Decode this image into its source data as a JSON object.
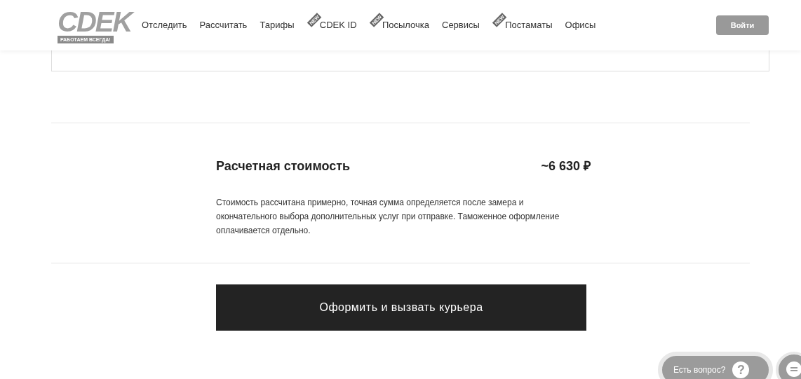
{
  "header": {
    "logo": {
      "wordmark": "CDEK",
      "slogan": "РАБОТАЕМ ВСЕГДА!"
    },
    "nav": [
      {
        "label": "Отследить"
      },
      {
        "label": "Рассчитать"
      },
      {
        "label": "Тарифы"
      },
      {
        "label": "CDEK ID",
        "badge": "NEW"
      },
      {
        "label": "Посылочка",
        "badge": "NEW"
      },
      {
        "label": "Сервисы"
      },
      {
        "label": "Постаматы",
        "badge": "NEW"
      },
      {
        "label": "Офисы"
      }
    ],
    "login_button": "Войти"
  },
  "estimate": {
    "title": "Расчетная стоимость",
    "price": "~6 630 ₽",
    "note": "Стоимость рассчитана примерно, точная сумма определяется после замера и окончательного выбора дополнительных услуг при отправке. Таможенное оформление оплачивается отдельно."
  },
  "submit_button": "Оформить и вызвать курьера",
  "help_widget": {
    "label": "Есть вопрос?",
    "icon_text": "?"
  }
}
